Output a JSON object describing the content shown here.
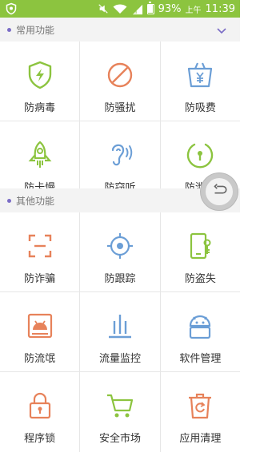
{
  "status_bar": {
    "battery": "93%",
    "ampm": "上午",
    "time": "11:39",
    "battery_level": 0.93
  },
  "sections": [
    {
      "title": "常用功能",
      "toggle_icon": "chevron-down-icon",
      "tiles": [
        {
          "label": "防病毒",
          "icon": "shield-bolt-icon",
          "color": "#8cc43f"
        },
        {
          "label": "防骚扰",
          "icon": "block-icon",
          "color": "#e7825a"
        },
        {
          "label": "防吸费",
          "icon": "yuan-basket-icon",
          "color": "#6b9ed6"
        },
        {
          "label": "防卡慢",
          "icon": "rocket-icon",
          "color": "#8cc43f"
        },
        {
          "label": "防窃听",
          "icon": "ear-icon",
          "color": "#6b9ed6"
        },
        {
          "label": "防泄密",
          "icon": "lock-circle-icon",
          "color": "#8cc43f"
        }
      ]
    },
    {
      "title": "其他功能",
      "tiles": [
        {
          "label": "防诈骗",
          "icon": "scan-frame-icon",
          "color": "#e7825a"
        },
        {
          "label": "防跟踪",
          "icon": "crosshair-icon",
          "color": "#6b9ed6"
        },
        {
          "label": "防盗失",
          "icon": "phone-key-icon",
          "color": "#8cc43f"
        },
        {
          "label": "防流氓",
          "icon": "android-box-icon",
          "color": "#e7825a"
        },
        {
          "label": "流量监控",
          "icon": "bars-icon",
          "color": "#6b9ed6"
        },
        {
          "label": "软件管理",
          "icon": "android-icon",
          "color": "#6b9ed6"
        },
        {
          "label": "程序锁",
          "icon": "padlock-icon",
          "color": "#e7825a"
        },
        {
          "label": "安全市场",
          "icon": "cart-icon",
          "color": "#8cc43f"
        },
        {
          "label": "应用清理",
          "icon": "trash-refresh-icon",
          "color": "#e7825a"
        }
      ]
    }
  ],
  "float_button": {
    "icon": "back-arrow-icon"
  }
}
